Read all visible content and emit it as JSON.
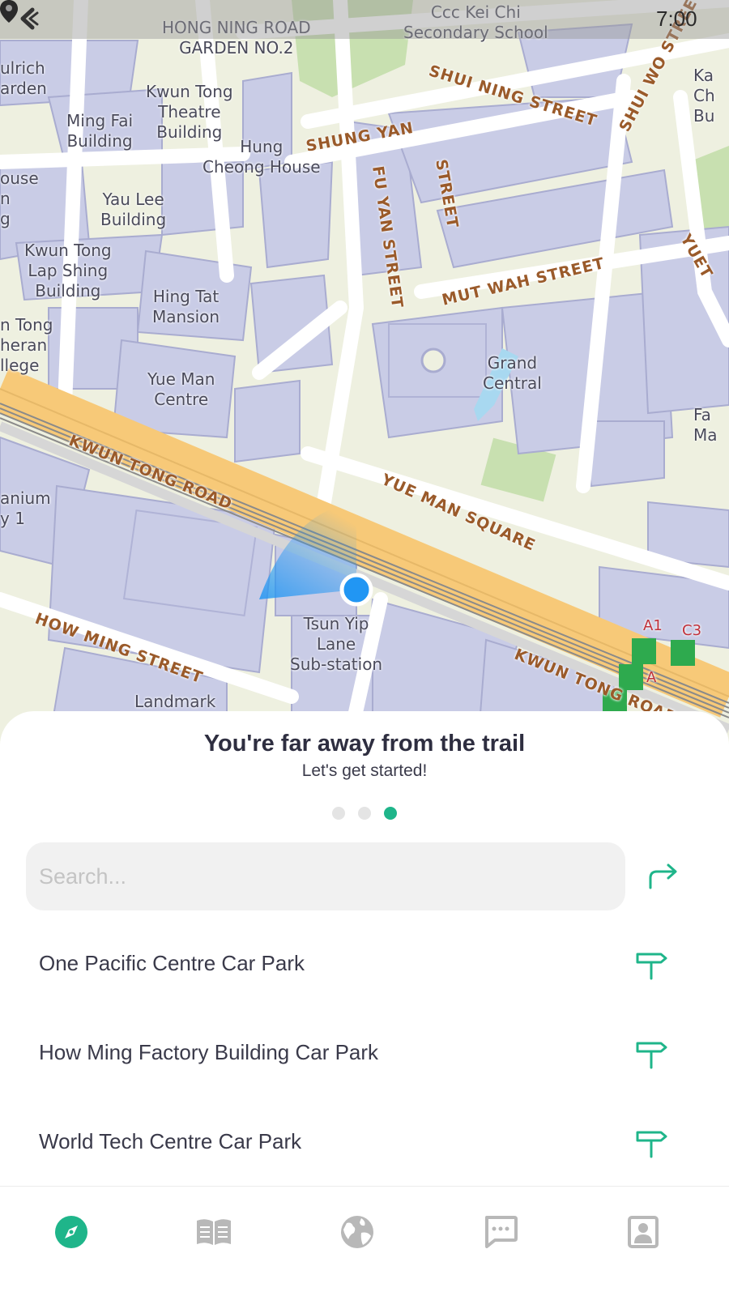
{
  "status_bar": {
    "time": "7:00"
  },
  "map": {
    "buildings": [
      "HONG NING ROAD\nGARDEN NO.2",
      "Ccc Kei Chi\nSecondary School",
      "Kwun Tong\nTheatre\nBuilding",
      "Ming Fai\nBuilding",
      "Hung\nCheong House",
      "Yau Lee\nBuilding",
      "Kwun Tong\nLap Shing\nBuilding",
      "Hing Tat\nMansion",
      "Grand\nCentral",
      "Yue Man\nCentre",
      "Tsun Yip\nLane\nSub-station",
      "Landmark",
      "ulrich\narden",
      "ouse\nn\ng",
      "n Tong\nheran\nllege",
      "anium\ny 1",
      "Ka\nCh\nBu",
      "Fa\nMa"
    ],
    "roads": [
      "SHUI NING STREET",
      "SHUI WO STREET",
      "SHUNG YAN",
      "FU YAN STREET",
      "STREET",
      "MUT WAH STREET",
      "YUET",
      "KWUN TONG ROAD",
      "YUE MAN SQUARE",
      "HOW MING STREET",
      "KWUN TONG ROAD"
    ],
    "exits": [
      "A1",
      "C3",
      "A"
    ]
  },
  "sheet": {
    "title": "You're far away from the trail",
    "subtitle": "Let's get started!",
    "pager_total": 3,
    "pager_active": 3,
    "search": {
      "placeholder": "Search...",
      "value": ""
    },
    "results": [
      {
        "label": "One Pacific Centre Car Park",
        "icon": "signpost-icon"
      },
      {
        "label": "How Ming Factory Building Car Park",
        "icon": "signpost-icon"
      },
      {
        "label": "World Tech Centre Car Park",
        "icon": "signpost-icon"
      }
    ]
  },
  "nav": {
    "items": [
      {
        "name": "explore",
        "icon": "compass-icon",
        "active": true
      },
      {
        "name": "guide",
        "icon": "book-icon",
        "active": false
      },
      {
        "name": "world",
        "icon": "globe-icon",
        "active": false
      },
      {
        "name": "messages",
        "icon": "chat-icon",
        "active": false
      },
      {
        "name": "profile",
        "icon": "profile-icon",
        "active": false
      }
    ]
  },
  "colors": {
    "accent": "#1fb58a",
    "location_dot": "#2196f3",
    "building": "#c9cce6",
    "road_major": "#f7c978",
    "park": "#c8e0b0",
    "icon_inactive": "#b8b8b8"
  }
}
